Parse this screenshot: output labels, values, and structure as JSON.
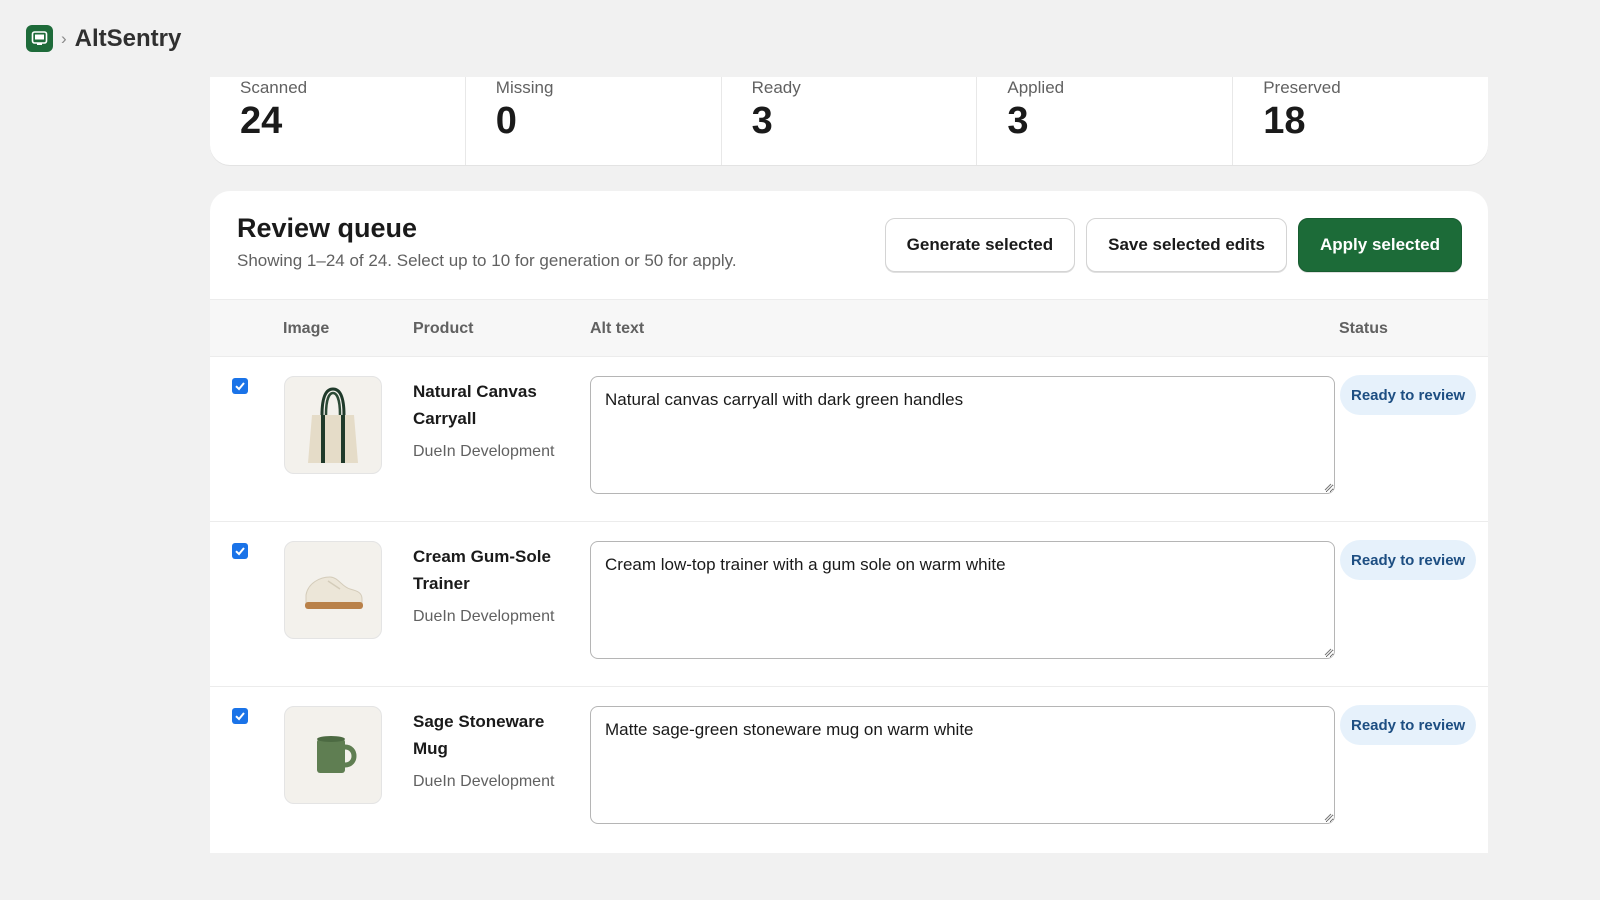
{
  "app": {
    "title": "AltSentry",
    "icon": "image-app-icon"
  },
  "stats": [
    {
      "label": "Scanned",
      "value": "24"
    },
    {
      "label": "Missing",
      "value": "0"
    },
    {
      "label": "Ready",
      "value": "3"
    },
    {
      "label": "Applied",
      "value": "3"
    },
    {
      "label": "Preserved",
      "value": "18"
    }
  ],
  "queue": {
    "title": "Review queue",
    "subtitle": "Showing 1–24 of 24. Select up to 10 for generation or 50 for apply.",
    "actions": {
      "generate": "Generate selected",
      "save": "Save selected edits",
      "apply": "Apply selected"
    },
    "columns": {
      "image": "Image",
      "product": "Product",
      "alt": "Alt text",
      "status": "Status"
    },
    "rows": [
      {
        "product": "Natural Canvas Carryall",
        "vendor": "DueIn Development",
        "alt": "Natural canvas carryall with dark green handles",
        "status": "Ready to review",
        "checked": true,
        "thumb_icon": "tote-bag-icon"
      },
      {
        "product": "Cream Gum-Sole Trainer",
        "vendor": "DueIn Development",
        "alt": "Cream low-top trainer with a gum sole on warm white",
        "status": "Ready to review",
        "checked": true,
        "thumb_icon": "sneaker-icon"
      },
      {
        "product": "Sage Stoneware Mug",
        "vendor": "DueIn Development",
        "alt": "Matte sage-green stoneware mug on warm white",
        "status": "Ready to review",
        "checked": true,
        "thumb_icon": "mug-icon"
      }
    ]
  },
  "colors": {
    "primary": "#1c6b38",
    "badge_bg": "#e6f1fb",
    "badge_text": "#1d4e82",
    "checkbox": "#1a73e8"
  }
}
